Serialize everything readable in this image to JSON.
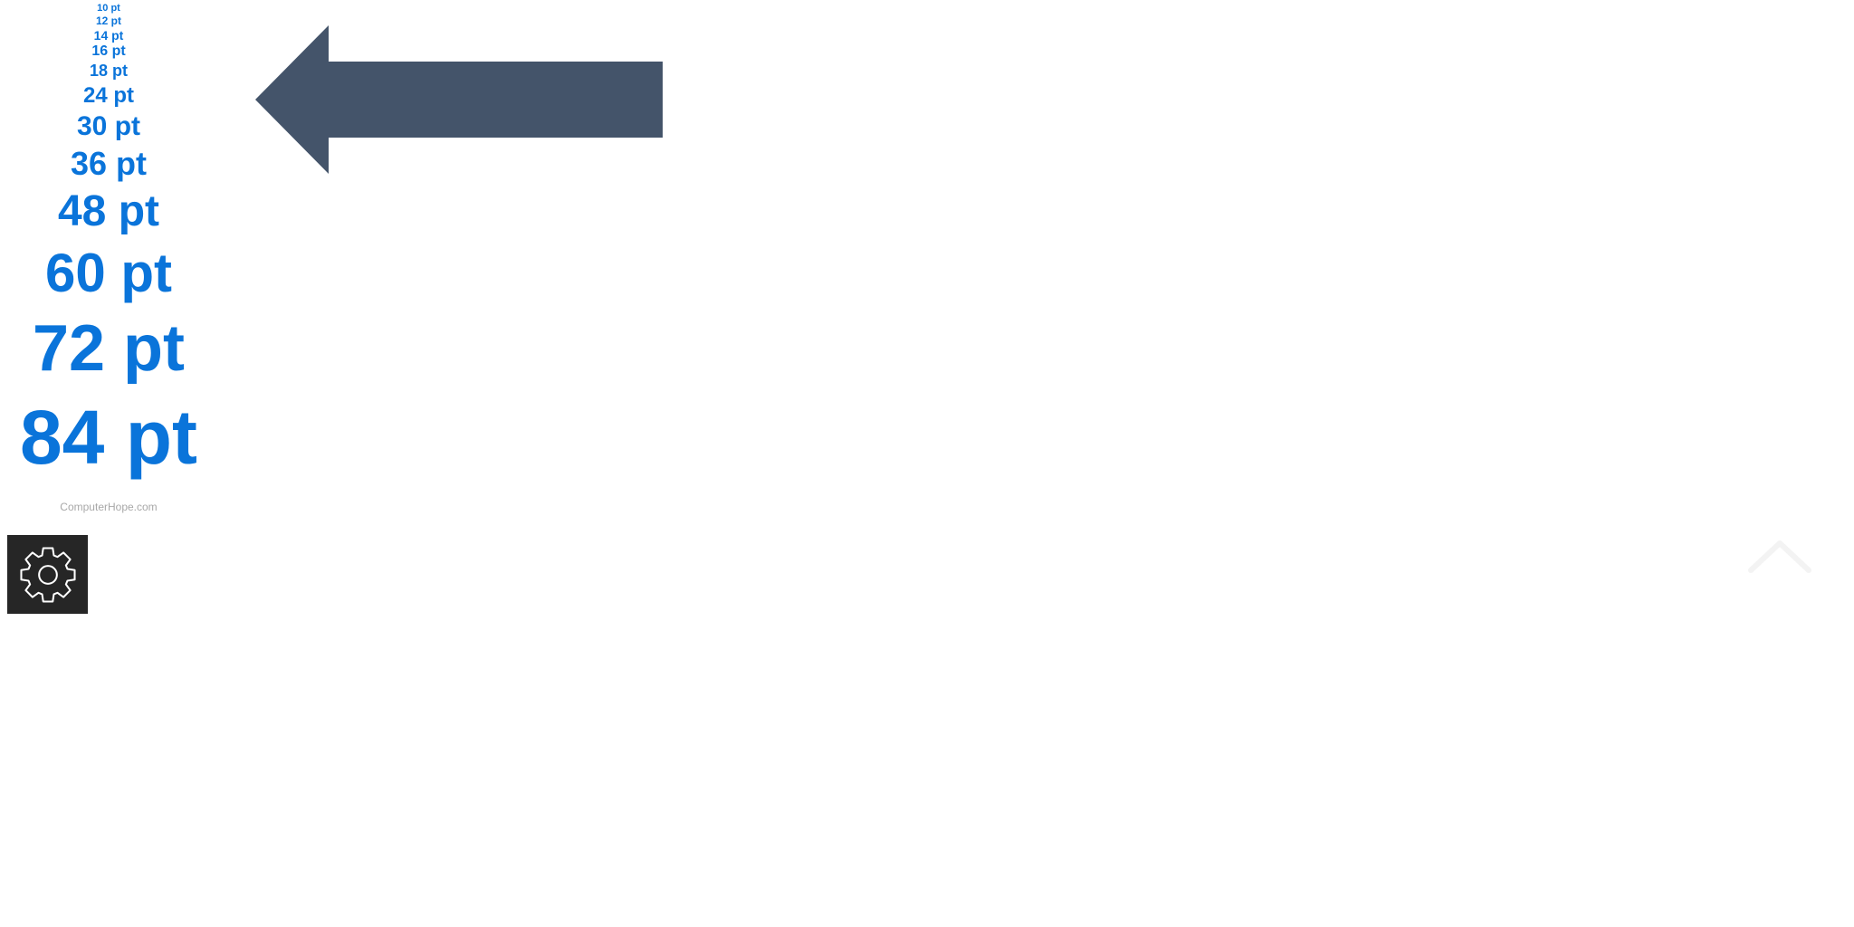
{
  "colors": {
    "label": "#0a74da",
    "arrow": "#44546a",
    "watermark": "#a8a8a8",
    "settings_bg": "#262626",
    "settings_icon": "#ffffff"
  },
  "font_sizes": {
    "items": [
      {
        "label": "10 pt"
      },
      {
        "label": "12 pt"
      },
      {
        "label": "14 pt"
      },
      {
        "label": "16 pt"
      },
      {
        "label": "18 pt"
      },
      {
        "label": "24 pt"
      },
      {
        "label": "30 pt"
      },
      {
        "label": "36 pt"
      },
      {
        "label": "48 pt"
      },
      {
        "label": "60 pt"
      },
      {
        "label": "72 pt"
      },
      {
        "label": "84 pt"
      }
    ]
  },
  "watermark": "ComputerHope.com",
  "icons": {
    "arrow": "left-arrow-icon",
    "settings": "gear-icon",
    "scroll_top": "chevron-up-icon"
  }
}
